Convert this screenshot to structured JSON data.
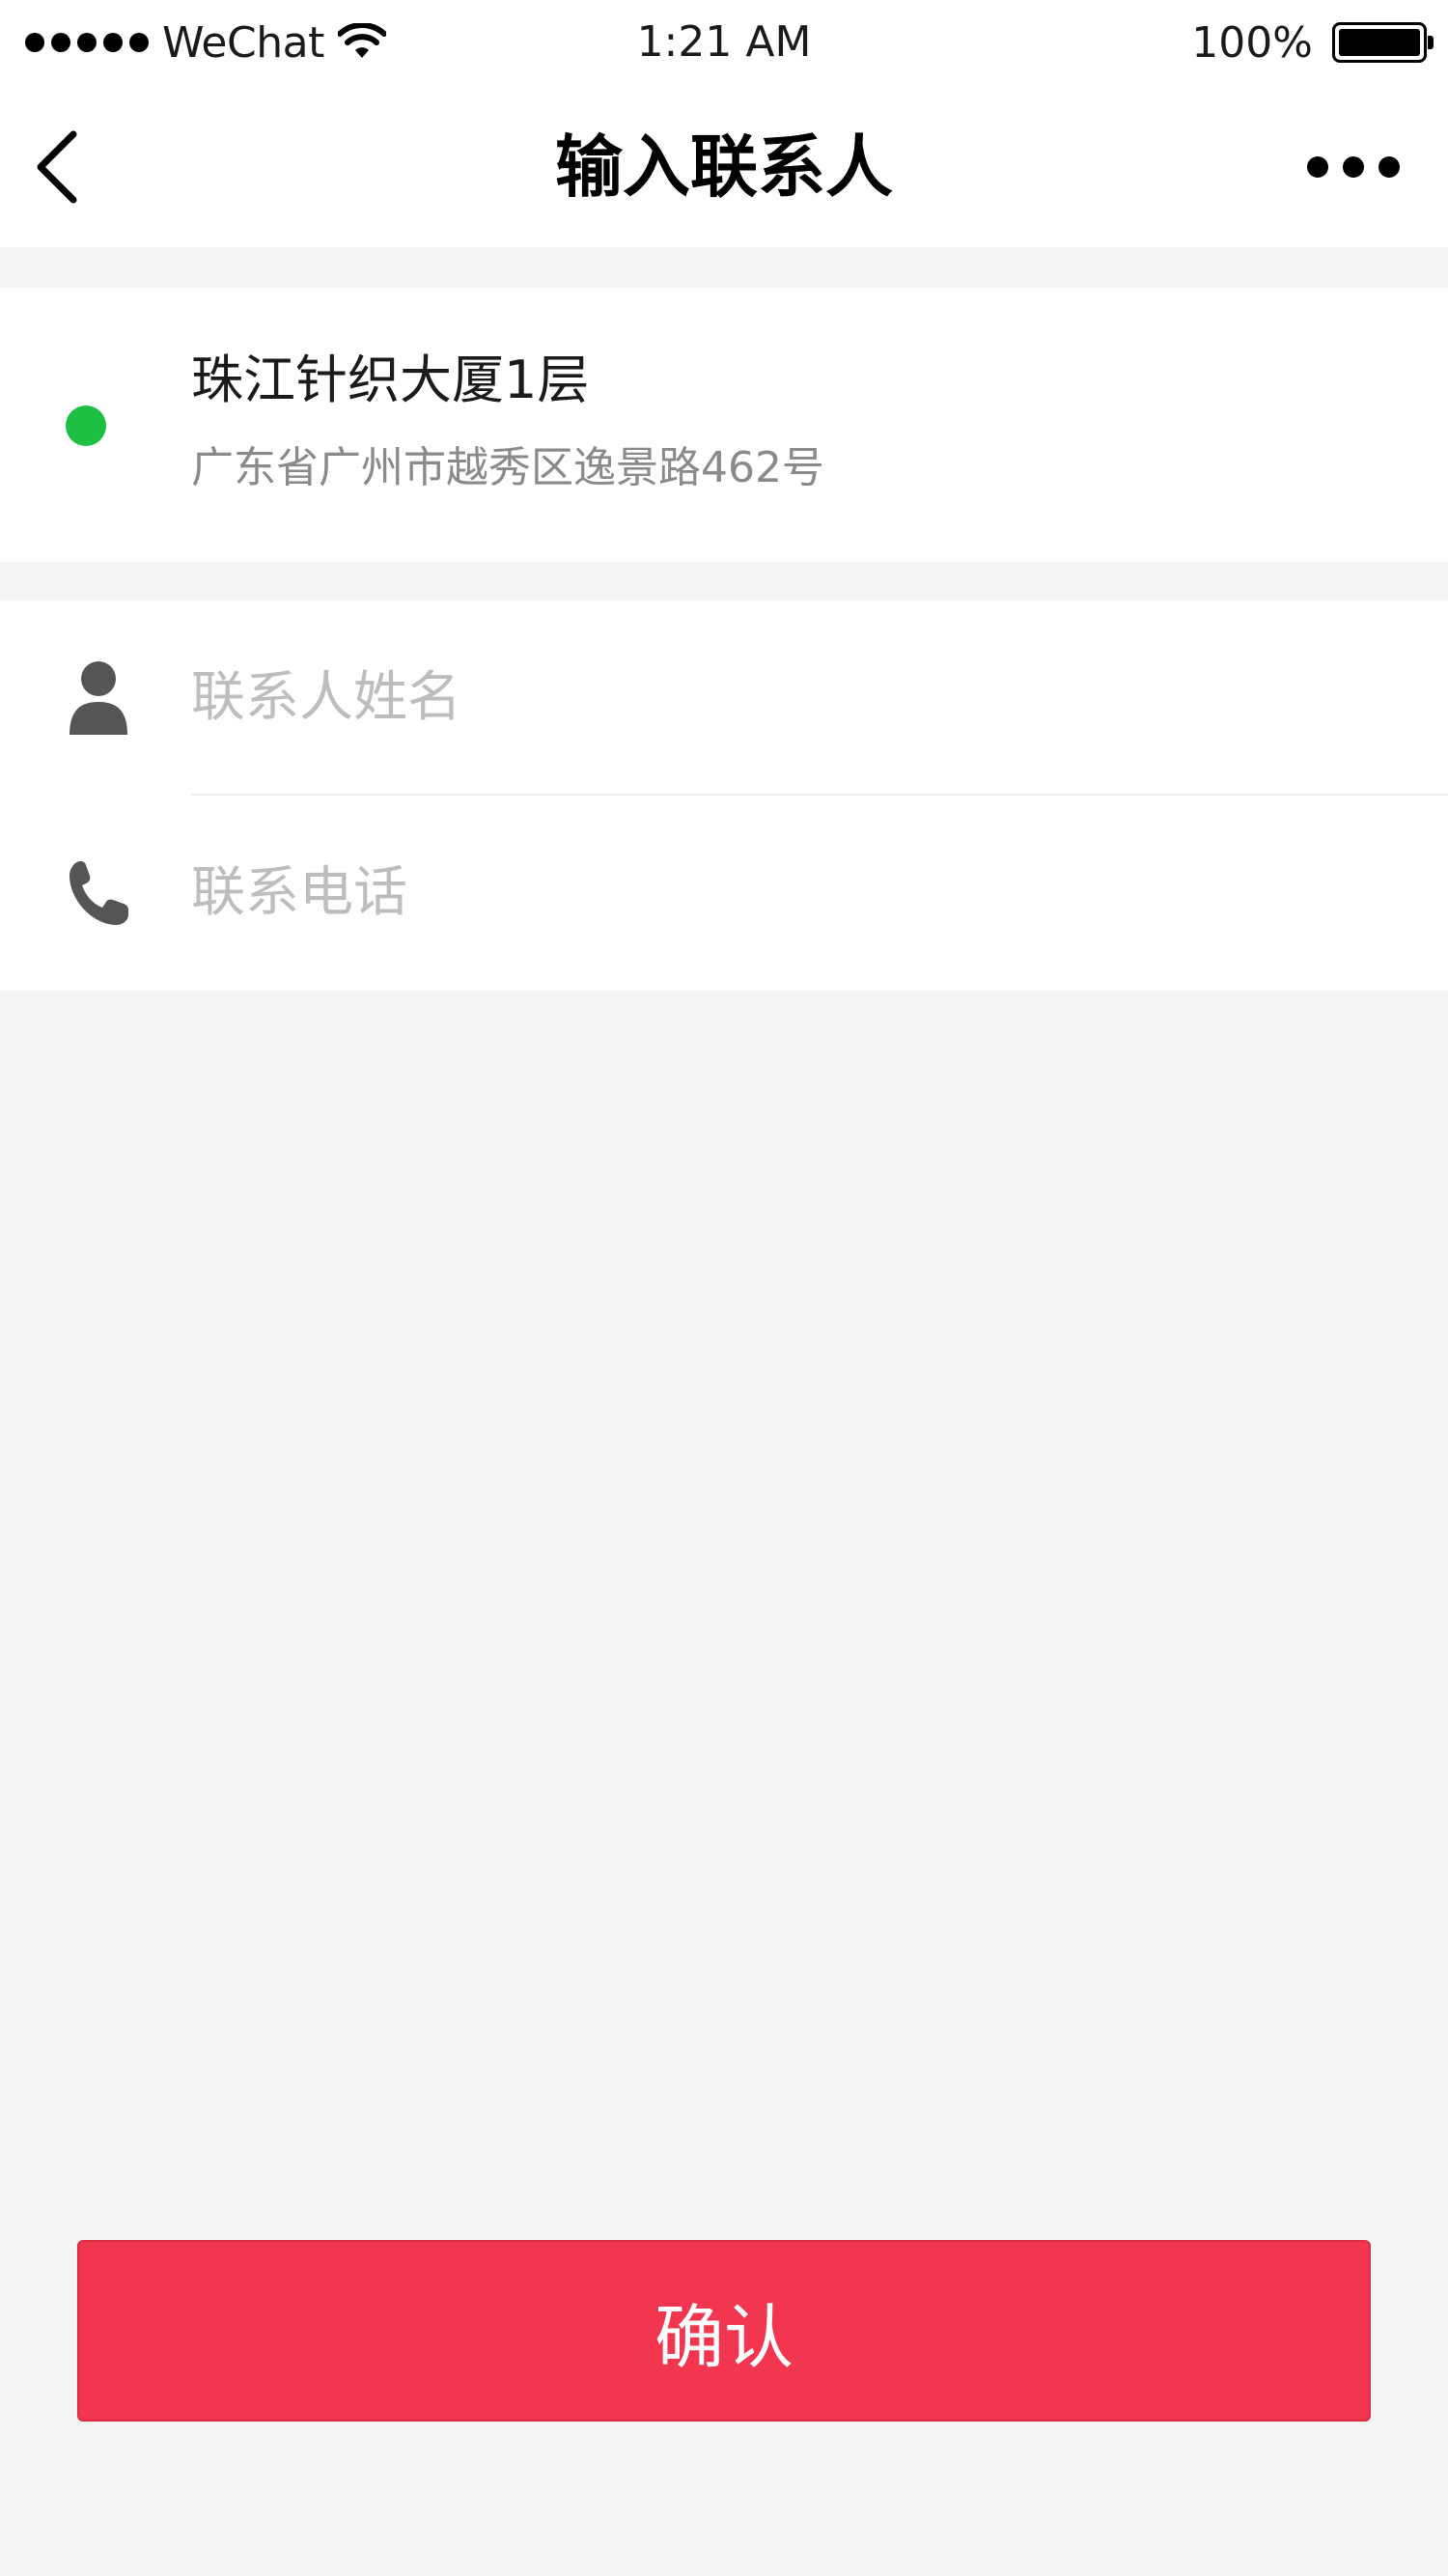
{
  "status_bar": {
    "carrier": "WeChat",
    "time": "1:21 AM",
    "battery": "100%",
    "icons": [
      "signal-dots-icon",
      "wifi-icon",
      "battery-icon"
    ]
  },
  "nav": {
    "title": "输入联系人",
    "back_icon": "chevron-left-icon",
    "more_icon": "more-dots-icon"
  },
  "location": {
    "name": "珠江针织大厦1层",
    "address": "广东省广州市越秀区逸景路462号",
    "status_icon": "green-dot-icon"
  },
  "form": {
    "name_field": {
      "icon": "person-icon",
      "placeholder": "联系人姓名",
      "value": ""
    },
    "phone_field": {
      "icon": "phone-icon",
      "placeholder": "联系电话",
      "value": ""
    }
  },
  "actions": {
    "confirm_label": "确认"
  },
  "colors": {
    "accent": "#f2364f",
    "status_green": "#1cc144",
    "background": "#f4f4f4",
    "icon_gray": "#555555"
  }
}
